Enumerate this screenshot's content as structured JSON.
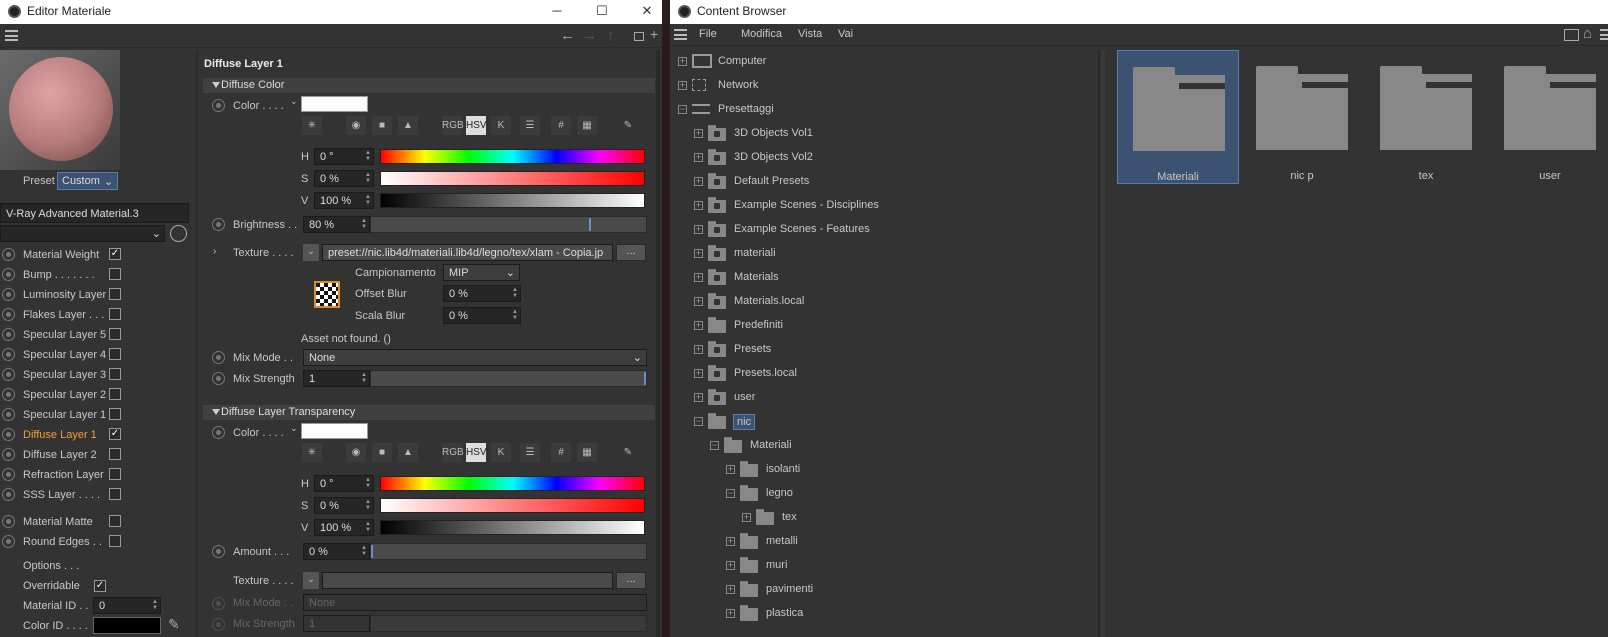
{
  "left_window": {
    "title": "Editor Materiale",
    "minimize": "─",
    "maximize": "☐",
    "close": "✕",
    "preset_label": "Preset",
    "preset_value": "Custom",
    "material_name": "V-Ray Advanced Material.3",
    "layers": [
      {
        "label": "Material Weight",
        "checked": true
      },
      {
        "label": "Bump . . . . . . .",
        "checked": false
      },
      {
        "label": "Luminosity Layer",
        "checked": false
      },
      {
        "label": "Flakes Layer . . .",
        "checked": false
      },
      {
        "label": "Specular Layer 5",
        "checked": false
      },
      {
        "label": "Specular Layer 4",
        "checked": false
      },
      {
        "label": "Specular Layer 3",
        "checked": false
      },
      {
        "label": "Specular Layer 2",
        "checked": false
      },
      {
        "label": "Specular Layer 1",
        "checked": false
      },
      {
        "label": "Diffuse Layer 1",
        "checked": true,
        "active": true
      },
      {
        "label": "Diffuse Layer 2",
        "checked": false
      },
      {
        "label": "Refraction Layer",
        "checked": false
      },
      {
        "label": "SSS Layer . . . .",
        "checked": false
      }
    ],
    "extra_layers": [
      {
        "label": "Material Matte"
      },
      {
        "label": "Round Edges . ."
      }
    ],
    "options_label": "Options . . .",
    "overridable_label": "Overridable",
    "material_id_label": "Material ID . .",
    "material_id_value": "0",
    "color_id_label": "Color ID . . . .",
    "section_title": "Diffuse Layer 1",
    "diffuse_color": {
      "header": "Diffuse Color",
      "color_label": "Color . . . .",
      "buttons": [
        "RGB",
        "HSV",
        "K",
        "#"
      ],
      "h_label": "H",
      "h_value": "0 °",
      "s_label": "S",
      "s_value": "0 %",
      "v_label": "V",
      "v_value": "100 %",
      "brightness_label": "Brightness . .",
      "brightness_value": "80 %",
      "brightness": 0.8,
      "texture_label": "Texture . . . .",
      "texture_path": "preset://nic.lib4d/materiali.lib4d/legno/tex/xlam - Copia.jp",
      "texture_btn": "...",
      "camp_label": "Campionamento",
      "camp_value": "MIP",
      "offset_label": "Offset Blur",
      "offset_value": "0 %",
      "scala_label": "Scala Blur",
      "scala_value": "0 %",
      "asset_msg": "Asset not found. ()",
      "mix_mode_label": "Mix Mode . .",
      "mix_mode_value": "None",
      "mix_strength_label": "Mix Strength",
      "mix_strength_value": "1",
      "mix_strength": 1.0
    },
    "transparency": {
      "header": "Diffuse Layer Transparency",
      "color_label": "Color . . . .",
      "buttons": [
        "RGB",
        "HSV",
        "K",
        "#"
      ],
      "h_label": "H",
      "h_value": "0 °",
      "s_label": "S",
      "s_value": "0 %",
      "v_label": "V",
      "v_value": "100 %",
      "amount_label": "Amount . . .",
      "amount_value": "0 %",
      "amount": 0.0,
      "texture_label": "Texture . . . .",
      "texture_btn": "...",
      "mix_mode_label": "Mix Mode . .",
      "mix_mode_value": "None",
      "mix_strength_label": "Mix Strength",
      "mix_strength_value": "1"
    }
  },
  "right_window": {
    "title": "Content Browser",
    "menu": [
      "File",
      "Modifica",
      "Vista",
      "Vai"
    ],
    "tree": [
      {
        "label": "Computer",
        "depth": 0,
        "icon": "computer-icon"
      },
      {
        "label": "Network",
        "depth": 0,
        "icon": "network-icon"
      },
      {
        "label": "Presettaggi",
        "depth": 0,
        "icon": "presets-icon"
      },
      {
        "label": "3D Objects Vol1",
        "depth": 1,
        "icon": "locked-folder-icon"
      },
      {
        "label": "3D Objects Vol2",
        "depth": 1,
        "icon": "locked-folder-icon"
      },
      {
        "label": "Default Presets",
        "depth": 1,
        "icon": "locked-folder-icon"
      },
      {
        "label": "Example Scenes - Disciplines",
        "depth": 1,
        "icon": "locked-folder-icon"
      },
      {
        "label": "Example Scenes - Features",
        "depth": 1,
        "icon": "locked-folder-icon"
      },
      {
        "label": "materiali",
        "depth": 1,
        "icon": "locked-folder-icon"
      },
      {
        "label": "Materials",
        "depth": 1,
        "icon": "locked-folder-icon"
      },
      {
        "label": "Materials.local",
        "depth": 1,
        "icon": "locked-folder-icon"
      },
      {
        "label": "Predefiniti",
        "depth": 1,
        "icon": "folder-icon"
      },
      {
        "label": "Presets",
        "depth": 1,
        "icon": "locked-folder-icon"
      },
      {
        "label": "Presets.local",
        "depth": 1,
        "icon": "locked-folder-icon"
      },
      {
        "label": "user",
        "depth": 1,
        "icon": "locked-folder-icon"
      },
      {
        "label": "nic",
        "depth": 1,
        "icon": "open-folder-icon",
        "selected": true
      },
      {
        "label": "Materiali",
        "depth": 2,
        "icon": "open-folder-icon"
      },
      {
        "label": "isolanti",
        "depth": 3,
        "icon": "folder-icon"
      },
      {
        "label": "legno",
        "depth": 3,
        "icon": "open-folder-icon"
      },
      {
        "label": "tex",
        "depth": 4,
        "icon": "folder-icon"
      },
      {
        "label": "metalli",
        "depth": 3,
        "icon": "folder-icon"
      },
      {
        "label": "muri",
        "depth": 3,
        "icon": "folder-icon"
      },
      {
        "label": "pavimenti",
        "depth": 3,
        "icon": "folder-icon"
      },
      {
        "label": "plastica",
        "depth": 3,
        "icon": "folder-icon"
      }
    ],
    "folders": [
      {
        "label": "Materiali",
        "selected": true
      },
      {
        "label": "nic p"
      },
      {
        "label": "tex"
      },
      {
        "label": "user"
      }
    ]
  }
}
